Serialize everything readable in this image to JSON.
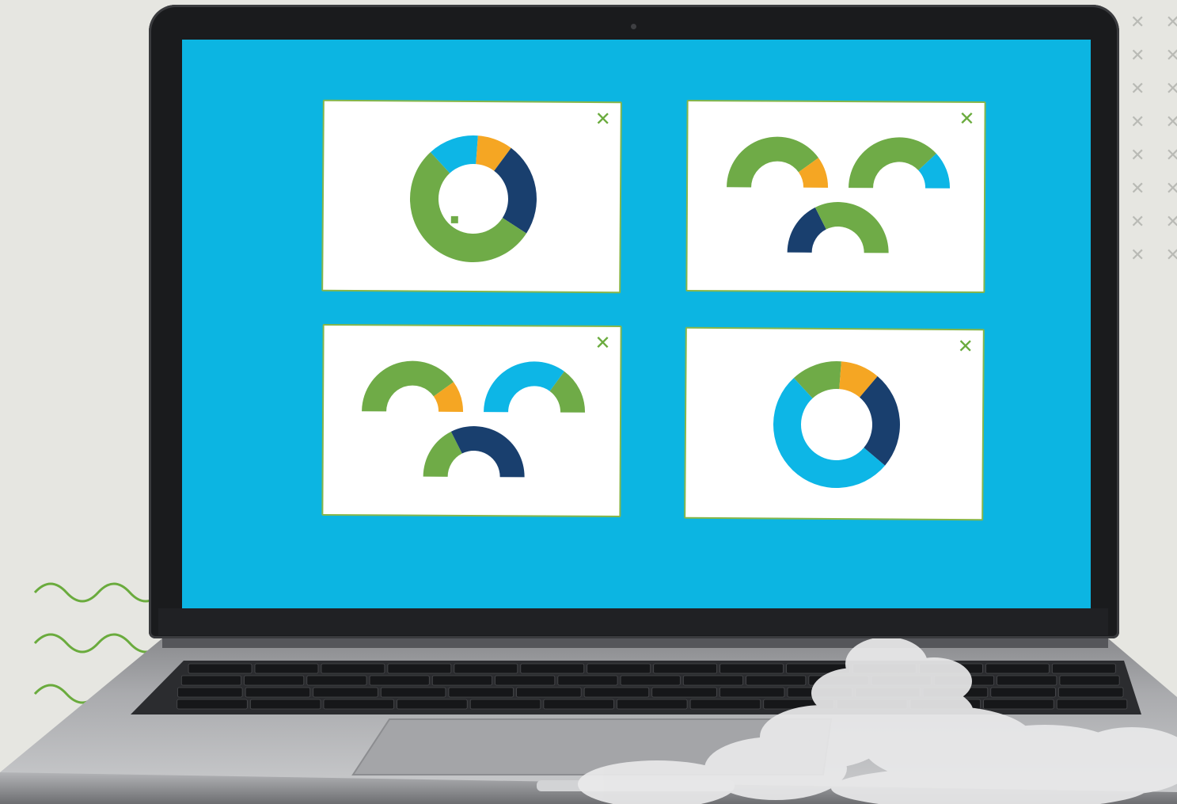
{
  "colors": {
    "green": "#6fab47",
    "sky": "#0db6e6",
    "orange": "#f5a623",
    "navy": "#193f6e",
    "screen": "#0cb5e2",
    "window_border": "#86b64a"
  },
  "windows": [
    {
      "close_glyph": "✕",
      "charts": [
        {
          "type": "donut",
          "segments": [
            {
              "color": "sky",
              "value": 13
            },
            {
              "color": "orange",
              "value": 9
            },
            {
              "color": "navy",
              "value": 24
            },
            {
              "color": "green",
              "value": 54
            }
          ]
        }
      ]
    },
    {
      "close_glyph": "✕",
      "charts": [
        {
          "type": "semi",
          "segments": [
            {
              "color": "green",
              "value": 80
            },
            {
              "color": "orange",
              "value": 20
            }
          ]
        },
        {
          "type": "semi",
          "segments": [
            {
              "color": "green",
              "value": 76
            },
            {
              "color": "sky",
              "value": 24
            }
          ]
        },
        {
          "type": "semi",
          "segments": [
            {
              "color": "navy",
              "value": 35
            },
            {
              "color": "green",
              "value": 65
            }
          ]
        }
      ]
    },
    {
      "close_glyph": "✕",
      "charts": [
        {
          "type": "semi",
          "segments": [
            {
              "color": "green",
              "value": 80
            },
            {
              "color": "orange",
              "value": 20
            }
          ]
        },
        {
          "type": "semi",
          "segments": [
            {
              "color": "sky",
              "value": 70
            },
            {
              "color": "green",
              "value": 30
            }
          ]
        },
        {
          "type": "semi",
          "segments": [
            {
              "color": "green",
              "value": 35
            },
            {
              "color": "navy",
              "value": 65
            }
          ]
        }
      ]
    },
    {
      "close_glyph": "✕",
      "charts": [
        {
          "type": "donut",
          "segments": [
            {
              "color": "green",
              "value": 13
            },
            {
              "color": "orange",
              "value": 10
            },
            {
              "color": "navy",
              "value": 25
            },
            {
              "color": "sky",
              "value": 52
            }
          ]
        }
      ]
    }
  ]
}
